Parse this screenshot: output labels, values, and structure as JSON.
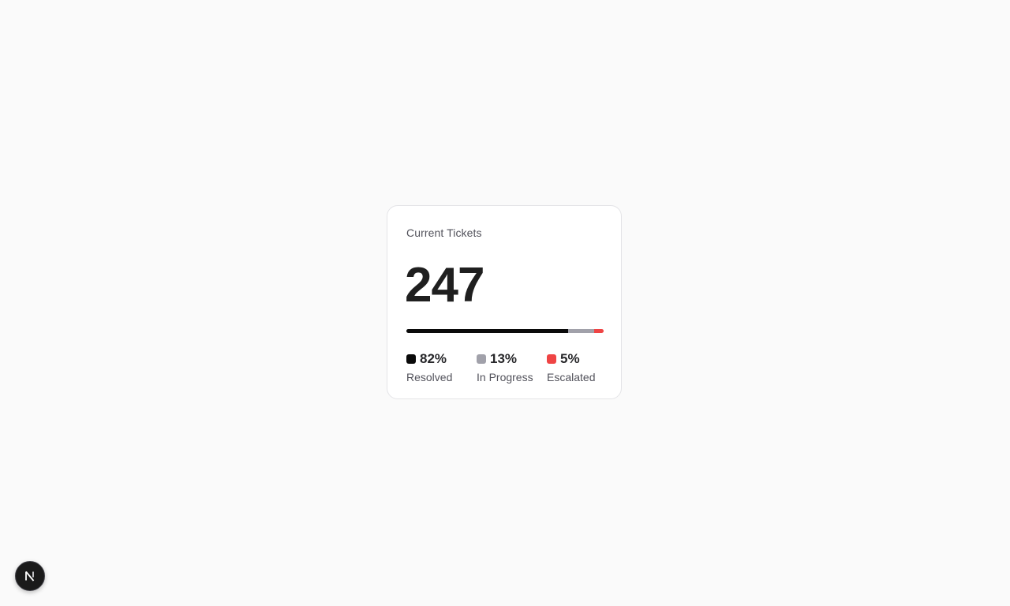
{
  "card": {
    "title": "Current Tickets",
    "total": "247",
    "segments": [
      {
        "label": "Resolved",
        "percent_text": "82%",
        "value": 82,
        "color": "#0a0a0a"
      },
      {
        "label": "In Progress",
        "percent_text": "13%",
        "value": 13,
        "color": "#a1a1aa"
      },
      {
        "label": "Escalated",
        "percent_text": "5%",
        "value": 5,
        "color": "#ef4444"
      }
    ]
  },
  "badge": {
    "icon": "nextjs-logo-icon"
  }
}
